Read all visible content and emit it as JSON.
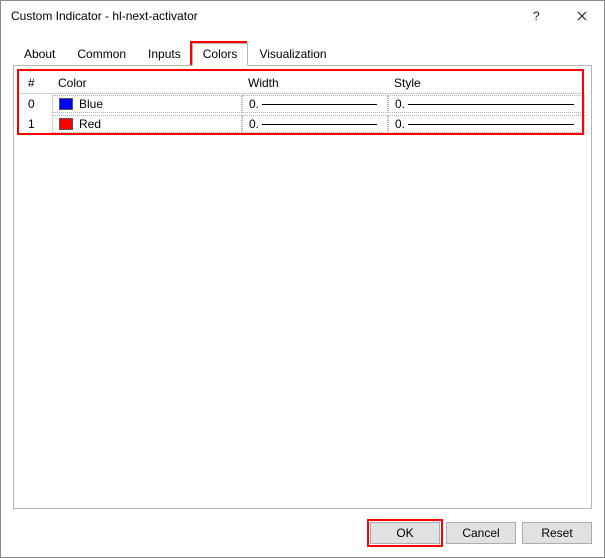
{
  "titlebar": {
    "title": "Custom Indicator - hl-next-activator"
  },
  "tabs": {
    "about": "About",
    "common": "Common",
    "inputs": "Inputs",
    "colors": "Colors",
    "visualization": "Visualization",
    "active": "colors"
  },
  "table": {
    "headers": {
      "idx": "#",
      "color": "Color",
      "width": "Width",
      "style": "Style"
    },
    "rows": [
      {
        "idx": "0",
        "colorName": "Blue",
        "colorHex": "#0000ff",
        "width": "0.",
        "style": "0."
      },
      {
        "idx": "1",
        "colorName": "Red",
        "colorHex": "#ff0000",
        "width": "0.",
        "style": "0."
      }
    ]
  },
  "buttons": {
    "ok": "OK",
    "cancel": "Cancel",
    "reset": "Reset"
  }
}
